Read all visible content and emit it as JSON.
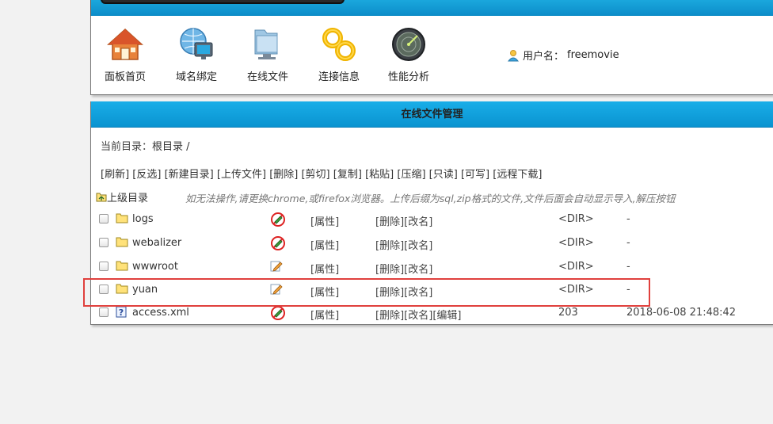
{
  "nav": {
    "items": [
      {
        "label": "面板首页",
        "icon": "house-icon"
      },
      {
        "label": "域名绑定",
        "icon": "globe-monitor-icon"
      },
      {
        "label": "在线文件",
        "icon": "folder-monitor-icon"
      },
      {
        "label": "连接信息",
        "icon": "link-chain-icon"
      },
      {
        "label": "性能分析",
        "icon": "radar-gauge-icon"
      }
    ],
    "user_label": "用户名：",
    "username": "freemovie"
  },
  "main": {
    "title": "在线文件管理",
    "current_dir_label": "当前目录：",
    "current_dir_path": "根目录 /",
    "toolbar": [
      "[刷新]",
      "[反选]",
      "[新建目录]",
      "[上传文件]",
      "[删除]",
      "[剪切]",
      "[复制]",
      "[粘贴]",
      "[压缩]",
      "[只读]",
      "[可写]",
      "[远程下载]"
    ],
    "up_label": "上级目录",
    "hint": "如无法操作,请更换chrome,或firefox浏览器。上传后缀为sql,zip格式的文件,文件后面会自动显示导入,解压按钮",
    "attr_label": "[属性]",
    "delete_label": "[删除]",
    "rename_label": "[改名]",
    "edit_label": "[编辑]",
    "files": [
      {
        "name": "logs",
        "type": "dir",
        "perm": "readonly",
        "size": "<DIR>",
        "mtime": "-"
      },
      {
        "name": "webalizer",
        "type": "dir",
        "perm": "readonly",
        "size": "<DIR>",
        "mtime": "-"
      },
      {
        "name": "wwwroot",
        "type": "dir",
        "perm": "writable",
        "size": "<DIR>",
        "mtime": "-"
      },
      {
        "name": "yuan",
        "type": "dir",
        "perm": "writable",
        "size": "<DIR>",
        "mtime": "-"
      },
      {
        "name": "access.xml",
        "type": "file",
        "perm": "readonly",
        "size": "203",
        "mtime": "2018-06-08 21:48:42"
      }
    ]
  },
  "colors": {
    "header_blue": "#0a93d0",
    "highlight_red": "#e0403d"
  }
}
